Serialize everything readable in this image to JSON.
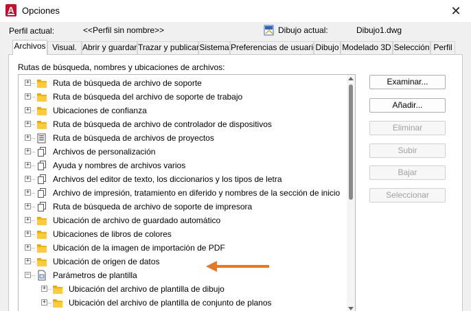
{
  "window": {
    "title": "Opciones",
    "app_icon_letter": "A",
    "close_glyph": "✕"
  },
  "profile": {
    "label": "Perfil actual:",
    "value": "<<Perfil sin nombre>>"
  },
  "drawing": {
    "label": "Dibujo actual:",
    "value": "Dibujo1.dwg"
  },
  "tabs": [
    {
      "label": "Archivos",
      "active": true
    },
    {
      "label": "Visual."
    },
    {
      "label": "Abrir y guardar"
    },
    {
      "label": "Trazar y publicar"
    },
    {
      "label": "Sistema"
    },
    {
      "label": "Preferencias de usuario"
    },
    {
      "label": "Dibujo"
    },
    {
      "label": "Modelado 3D"
    },
    {
      "label": "Selección"
    },
    {
      "label": "Perfil"
    }
  ],
  "panel": {
    "section_label": "Rutas de búsqueda, nombres y ubicaciones de archivos:"
  },
  "tree": {
    "items": [
      {
        "label": "Ruta de búsqueda de archivo de soporte",
        "icon": "folder-icon",
        "expander": "+"
      },
      {
        "label": "Ruta de búsqueda del archivo de soporte de trabajo",
        "icon": "folder-icon",
        "expander": "+"
      },
      {
        "label": "Ubicaciones de confianza",
        "icon": "folder-icon",
        "expander": "+"
      },
      {
        "label": "Ruta de búsqueda de archivo de controlador de dispositivos",
        "icon": "folder-icon",
        "expander": "+"
      },
      {
        "label": "Ruta de búsqueda de archivos de proyectos",
        "icon": "project-icon",
        "expander": "+"
      },
      {
        "label": "Archivos de personalización",
        "icon": "documents-icon",
        "expander": "+"
      },
      {
        "label": "Ayuda y nombres de archivos varios",
        "icon": "documents-icon",
        "expander": "+"
      },
      {
        "label": "Archivos del editor de texto, los diccionarios y los tipos de letra",
        "icon": "documents-icon",
        "expander": "+"
      },
      {
        "label": "Archivo de impresión, tratamiento en diferido y nombres de la sección de inicio",
        "icon": "documents-icon",
        "expander": "+"
      },
      {
        "label": "Ruta de búsqueda de archivo de soporte de impresora",
        "icon": "documents-icon",
        "expander": "+"
      },
      {
        "label": "Ubicación de archivo de guardado automático",
        "icon": "folder-icon",
        "expander": "+"
      },
      {
        "label": "Ubicaciones de libros de colores",
        "icon": "folder-icon",
        "expander": "+"
      },
      {
        "label": "Ubicación de la imagen de importación de PDF",
        "icon": "folder-icon",
        "expander": "+"
      },
      {
        "label": "Ubicación de origen de datos",
        "icon": "folder-icon",
        "expander": "+"
      },
      {
        "label": "Parámetros de plantilla",
        "icon": "template-icon",
        "expander": "−"
      },
      {
        "label": "Ubicación del archivo de plantilla de dibujo",
        "icon": "folder-icon",
        "expander": "+",
        "level": 2
      },
      {
        "label": "Ubicación del archivo de plantilla de conjunto de planos",
        "icon": "folder-icon",
        "expander": "+",
        "level": 2
      }
    ]
  },
  "buttons": {
    "browse": "Examinar...",
    "add": "Añadir...",
    "remove": "Eliminar",
    "move_up": "Subir",
    "move_down": "Bajar",
    "set_current": "Seleccionar"
  },
  "colors": {
    "accent_arrow": "#e87722",
    "folder": "#f3b400",
    "app_icon": "#c8102e"
  }
}
